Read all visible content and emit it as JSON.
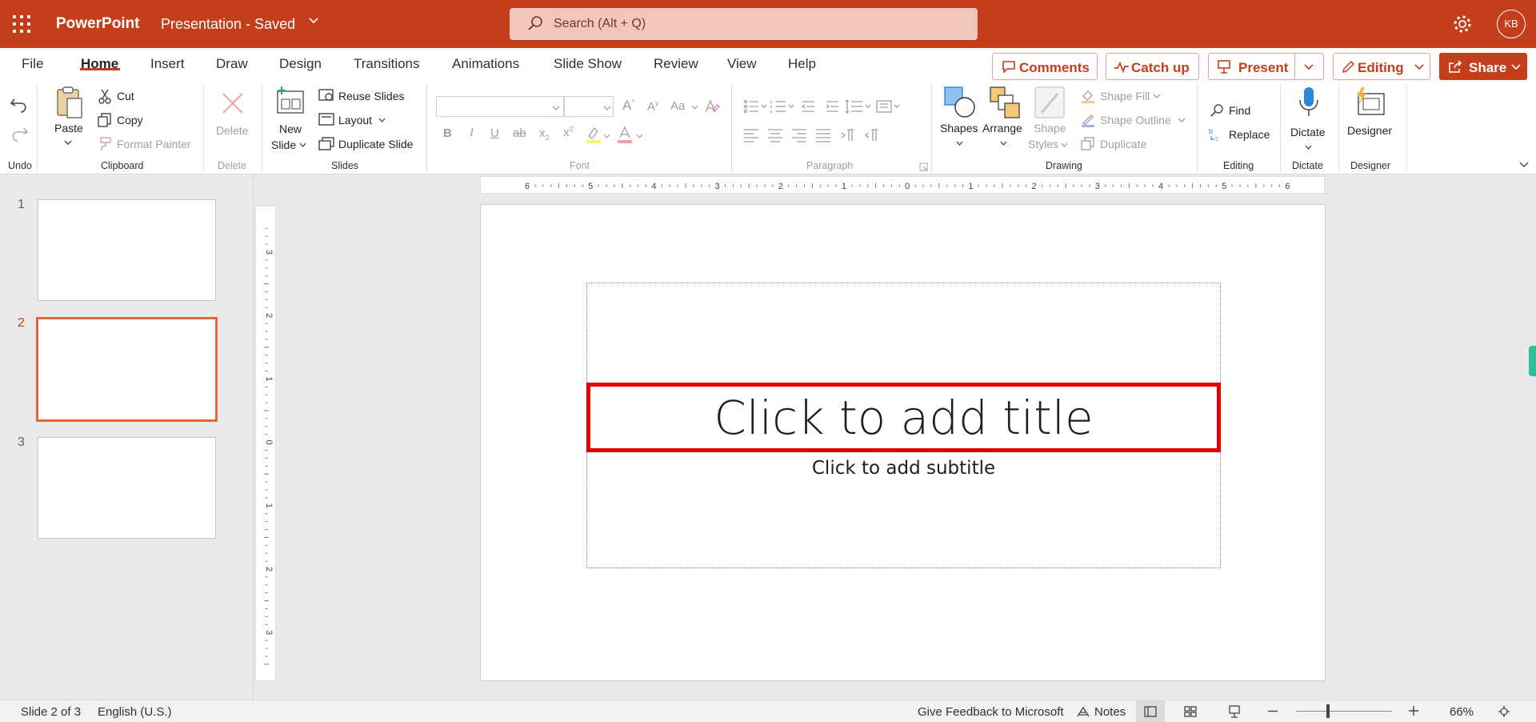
{
  "titlebar": {
    "app_name": "PowerPoint",
    "doc_title": "Presentation - Saved",
    "search_placeholder": "Search (Alt + Q)",
    "avatar_initials": "KB",
    "brand_color": "#c43e1c"
  },
  "ribbon": {
    "tabs": [
      "File",
      "Home",
      "Insert",
      "Draw",
      "Design",
      "Transitions",
      "Animations",
      "Slide Show",
      "Review",
      "View",
      "Help"
    ],
    "active_tab": "Home",
    "actions": {
      "comments": "Comments",
      "catch_up": "Catch up",
      "present": "Present",
      "editing": "Editing",
      "share": "Share"
    },
    "groups": {
      "undo": "Undo",
      "clipboard": "Clipboard",
      "delete": "Delete",
      "slides": "Slides",
      "font": "Font",
      "paragraph": "Paragraph",
      "drawing": "Drawing",
      "editing": "Editing",
      "dictate": "Dictate",
      "designer": "Designer"
    },
    "clipboard": {
      "paste": "Paste",
      "cut": "Cut",
      "copy": "Copy",
      "format_painter": "Format Painter"
    },
    "delete": {
      "delete": "Delete"
    },
    "slides": {
      "new_slide_1": "New",
      "new_slide_2": "Slide",
      "reuse": "Reuse Slides",
      "layout": "Layout",
      "duplicate": "Duplicate Slide"
    },
    "font_controls": {
      "bold": "B",
      "italic": "I",
      "underline": "U",
      "strike": "ab",
      "sub": "x",
      "sup": "x",
      "change_case": "Aa"
    },
    "drawing": {
      "shapes": "Shapes",
      "arrange": "Arrange",
      "shape_styles_1": "Shape",
      "shape_styles_2": "Styles",
      "shape_fill": "Shape Fill",
      "shape_outline": "Shape Outline",
      "duplicate": "Duplicate"
    },
    "editing": {
      "find": "Find",
      "replace": "Replace"
    },
    "dictate": {
      "dictate": "Dictate"
    },
    "designer": {
      "designer": "Designer"
    }
  },
  "thumbnails": [
    {
      "number": "1",
      "selected": false
    },
    {
      "number": "2",
      "selected": true
    },
    {
      "number": "3",
      "selected": false
    }
  ],
  "ruler": {
    "horizontal": [
      "6",
      "5",
      "4",
      "3",
      "2",
      "1",
      "0",
      "1",
      "2",
      "3",
      "4",
      "5",
      "6"
    ],
    "vertical": [
      "3",
      "2",
      "1",
      "0",
      "1",
      "2",
      "3"
    ]
  },
  "slide": {
    "title_placeholder": "Click to add title",
    "subtitle_placeholder": "Click to add subtitle"
  },
  "statusbar": {
    "slide_info": "Slide 2 of 3",
    "language": "English (U.S.)",
    "feedback": "Give Feedback to Microsoft",
    "notes": "Notes",
    "zoom": "66%",
    "zoom_fraction": 0.66
  }
}
